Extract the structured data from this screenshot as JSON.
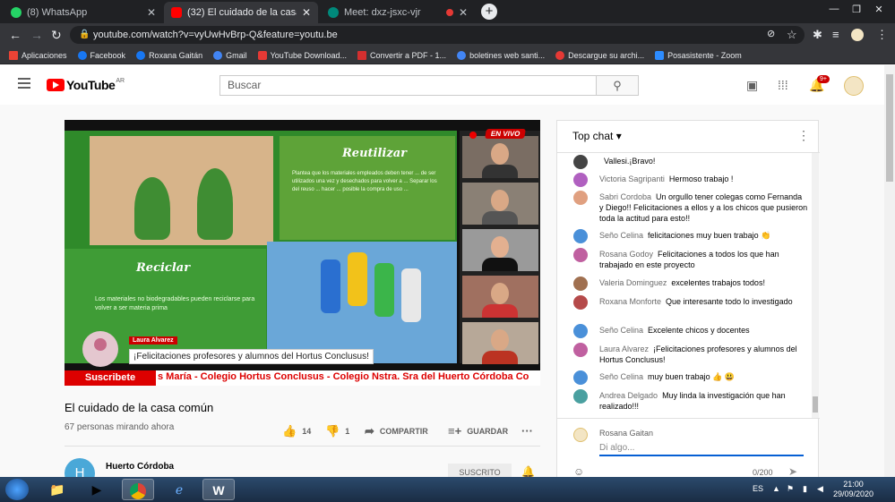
{
  "browser": {
    "tabs": [
      {
        "title": "(8) WhatsApp",
        "color": "#25d366"
      },
      {
        "title": "(32) El cuidado de la casa común",
        "color": "#ff0000"
      },
      {
        "title": "Meet: dxz-jsxc-vjr",
        "color": "#00897b"
      }
    ],
    "url": "youtube.com/watch?v=vyUwHvBrp-Q&feature=youtu.be",
    "bookmarks": [
      {
        "label": "Aplicaciones",
        "color": "#ea4335"
      },
      {
        "label": "Facebook",
        "color": "#1877f2"
      },
      {
        "label": "Roxana Gaitán",
        "color": "#1877f2"
      },
      {
        "label": "Gmail",
        "color": "#4285f4"
      },
      {
        "label": "YouTube Download...",
        "color": "#e53935"
      },
      {
        "label": "Convertir a PDF - 1...",
        "color": "#d32f2f"
      },
      {
        "label": "boletines web santi...",
        "color": "#4285f4"
      },
      {
        "label": "Descargue su archi...",
        "color": "#e53935"
      },
      {
        "label": "Posasistente - Zoom",
        "color": "#2d8cff"
      }
    ]
  },
  "youtube": {
    "logo_text": "YouTube",
    "country": "AR",
    "search_placeholder": "Buscar",
    "notifications": "9+"
  },
  "video": {
    "live_label": "EN VIVO",
    "slide_title_reuse": "Reutilizar",
    "slide_text_reuse": "Plantea que los materiales empleados deben tener ... de ser utilizados una vez y desechados para volver a ... Separar los del reuso ... hacer ... posible la compra de uso ...",
    "slide_title_recycle": "Reciclar",
    "slide_text_recycle": "Los materiales no biodegradables pueden reciclarse para volver a ser materia prima",
    "speaker_name": "Laura Alvarez",
    "speaker_message": "¡Felicitaciones profesores y alumnos del Hortus Conclusus!",
    "subscribe_label": "Suscribete",
    "ticker_text": "s María - Colegio Hortus Conclusus - Colegio Nstra. Sra del Huerto Córdoba    Co"
  },
  "meta": {
    "title": "El cuidado de la casa común",
    "viewers": "67 personas mirando ahora",
    "likes": "14",
    "dislikes": "1",
    "share_label": "COMPARTIR",
    "save_label": "GUARDAR",
    "channel_initial": "H",
    "channel_name": "Huerto Córdoba",
    "subscribed_label": "SUSCRITO"
  },
  "chat": {
    "title": "Top chat",
    "messages": [
      {
        "author": "",
        "text": "Vallesi.¡Bravo!",
        "color": "#444444"
      },
      {
        "author": "Victoria Sagripanti",
        "text": "Hermoso trabajo !",
        "color": "#b060c0"
      },
      {
        "author": "Sabri Cordoba",
        "text": "Un orgullo tener colegas como Fernanda y Diego!! Felicitaciones a ellos y a los chicos que pusieron toda la actitud para esto!!",
        "color": "#e0a080"
      },
      {
        "author": "Seño Celina",
        "text": "felicitaciones muy buen trabajo 👏",
        "color": "#4a90d9"
      },
      {
        "author": "Rosana Godoy",
        "text": "Felicitaciones a todos los que han trabajado en este proyecto",
        "color": "#c060a0"
      },
      {
        "author": "Valeria Dominguez",
        "text": "excelentes trabajos todos!",
        "color": "#a07050"
      },
      {
        "author": "Roxana Monforte",
        "text": "Que interesante todo lo investigado",
        "color": "#b54a4a"
      },
      {
        "author": "Seño Celina",
        "text": "Excelente chicos y docentes",
        "color": "#4a90d9"
      },
      {
        "author": "Laura Alvarez",
        "text": "¡Felicitaciones profesores y alumnos del Hortus Conclusus!",
        "color": "#c060a0"
      },
      {
        "author": "Seño Celina",
        "text": "muy buen trabajo 👍 😃",
        "color": "#4a90d9"
      },
      {
        "author": "Andrea Delgado",
        "text": "Muy linda la investigación que han realizado!!!",
        "color": "#4aa0a0"
      }
    ],
    "input_user": "Rosana Gaitan",
    "input_placeholder": "Di algo...",
    "char_count": "0/200"
  },
  "taskbar": {
    "language": "ES",
    "time": "21:00",
    "date": "29/09/2020"
  }
}
